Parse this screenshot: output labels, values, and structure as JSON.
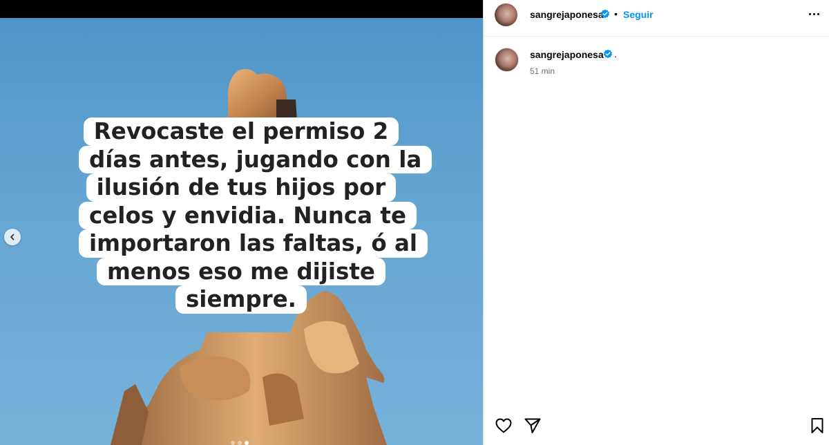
{
  "post": {
    "caption_lines": [
      "Revocaste el permiso 2",
      "días antes, jugando con la",
      "ilusión de tus hijos por",
      "celos y envidia. Nunca te",
      "importaron las faltas, ó al",
      "menos eso me dijiste",
      "siempre."
    ],
    "carousel": {
      "slide_count": 3,
      "active_index": 2
    }
  },
  "header": {
    "username": "sangrejaponesa",
    "separator": "•",
    "follow_label": "Seguir"
  },
  "comment": {
    "username": "sangrejaponesa",
    "text": ".",
    "time": "51 min"
  },
  "icons": {
    "verified": "verified-badge-icon",
    "like": "heart-icon",
    "share": "paper-plane-icon",
    "save": "bookmark-icon",
    "more": "more-options-icon",
    "prev": "chevron-left-icon"
  },
  "colors": {
    "accent": "#0095f6",
    "verified": "#0095f6",
    "muted": "#737373"
  }
}
